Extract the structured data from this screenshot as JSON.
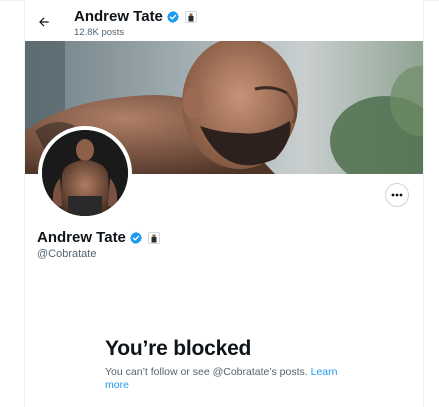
{
  "header": {
    "name": "Andrew Tate",
    "posts_count": "12.8K posts"
  },
  "profile": {
    "name": "Andrew Tate",
    "handle": "@Cobratate"
  },
  "blocked": {
    "title": "You’re blocked",
    "message": "You can’t follow or see @Cobratate’s posts.",
    "link_label": "Learn more"
  },
  "colors": {
    "accent": "#1d9bf0",
    "text_primary": "#0f1419",
    "text_secondary": "#536471",
    "border": "#cfd4da"
  },
  "icons": {
    "back": "arrow-left-icon",
    "verified": "verified-badge-icon",
    "affiliate": "affiliate-badge-icon",
    "more": "more-horizontal-icon"
  }
}
